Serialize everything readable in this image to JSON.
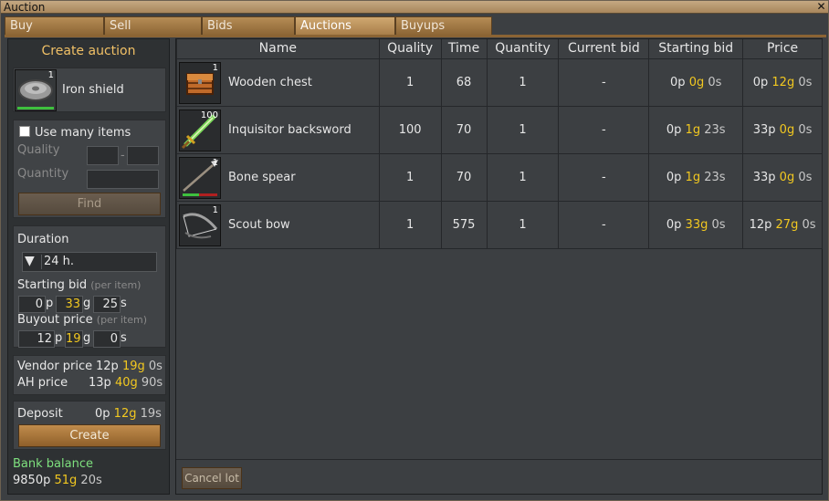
{
  "window": {
    "title": "Auction",
    "close_icon": "close-icon"
  },
  "tabs": [
    {
      "label": "Buy",
      "active": false
    },
    {
      "label": "Sell",
      "active": false
    },
    {
      "label": "Bids",
      "active": false
    },
    {
      "label": "Auctions",
      "active": true
    },
    {
      "label": "Buyups",
      "active": false
    }
  ],
  "create_panel": {
    "header": "Create auction",
    "item": {
      "name": "Iron shield",
      "count": "1",
      "icon": "shield-icon"
    },
    "use_many_items_label": "Use many items",
    "use_many_items_checked": false,
    "quality_label": "Quality",
    "quality_dash": "-",
    "quantity_label": "Quantity",
    "find_label": "Find",
    "duration_label": "Duration",
    "duration_value": "24 h.",
    "starting_bid_label": "Starting bid",
    "starting_bid_hint": "(per item)",
    "starting_bid": {
      "p": "0",
      "g": "33",
      "s": "25"
    },
    "buyout_label": "Buyout price",
    "buyout_hint": "(per item)",
    "buyout": {
      "p": "12",
      "g": "19",
      "s": "0"
    },
    "unit_p": "p",
    "unit_g": "g",
    "unit_s": "s",
    "vendor_price_label": "Vendor price",
    "vendor_price": {
      "p": "12p",
      "g": "19g",
      "s": "0s"
    },
    "ah_price_label": "AH price",
    "ah_price": {
      "p": "13p",
      "g": "40g",
      "s": "90s"
    },
    "deposit_label": "Deposit",
    "deposit": {
      "p": "0p",
      "g": "12g",
      "s": "19s"
    },
    "create_label": "Create",
    "bank_balance_label": "Bank balance",
    "bank_balance": {
      "p": "9850p",
      "g": "51g",
      "s": "20s"
    }
  },
  "auctions": {
    "columns": [
      "Name",
      "Quality",
      "Time",
      "Quantity",
      "Current bid",
      "Starting bid",
      "Price"
    ],
    "rows": [
      {
        "name": "Wooden chest",
        "count": "1",
        "icon": "chest-icon",
        "quality": "1",
        "time": "68",
        "quantity": "1",
        "current_bid": "-",
        "start_p": "0p",
        "start_g": "0g",
        "start_s": "0s",
        "price_p": "0p",
        "price_g": "12g",
        "price_s": "0s"
      },
      {
        "name": "Inquisitor backsword",
        "count": "100",
        "icon": "sword-icon",
        "quality": "100",
        "time": "70",
        "quantity": "1",
        "current_bid": "-",
        "start_p": "0p",
        "start_g": "1g",
        "start_s": "23s",
        "price_p": "33p",
        "price_g": "0g",
        "price_s": "0s"
      },
      {
        "name": "Bone spear",
        "count": "1",
        "icon": "spear-icon",
        "quality": "1",
        "time": "70",
        "quantity": "1",
        "current_bid": "-",
        "start_p": "0p",
        "start_g": "1g",
        "start_s": "23s",
        "price_p": "33p",
        "price_g": "0g",
        "price_s": "0s"
      },
      {
        "name": "Scout bow",
        "count": "1",
        "icon": "bow-icon",
        "quality": "1",
        "time": "575",
        "quantity": "1",
        "current_bid": "-",
        "start_p": "0p",
        "start_g": "33g",
        "start_s": "0s",
        "price_p": "12p",
        "price_g": "27g",
        "price_s": "0s"
      }
    ],
    "cancel_label": "Cancel lot"
  }
}
